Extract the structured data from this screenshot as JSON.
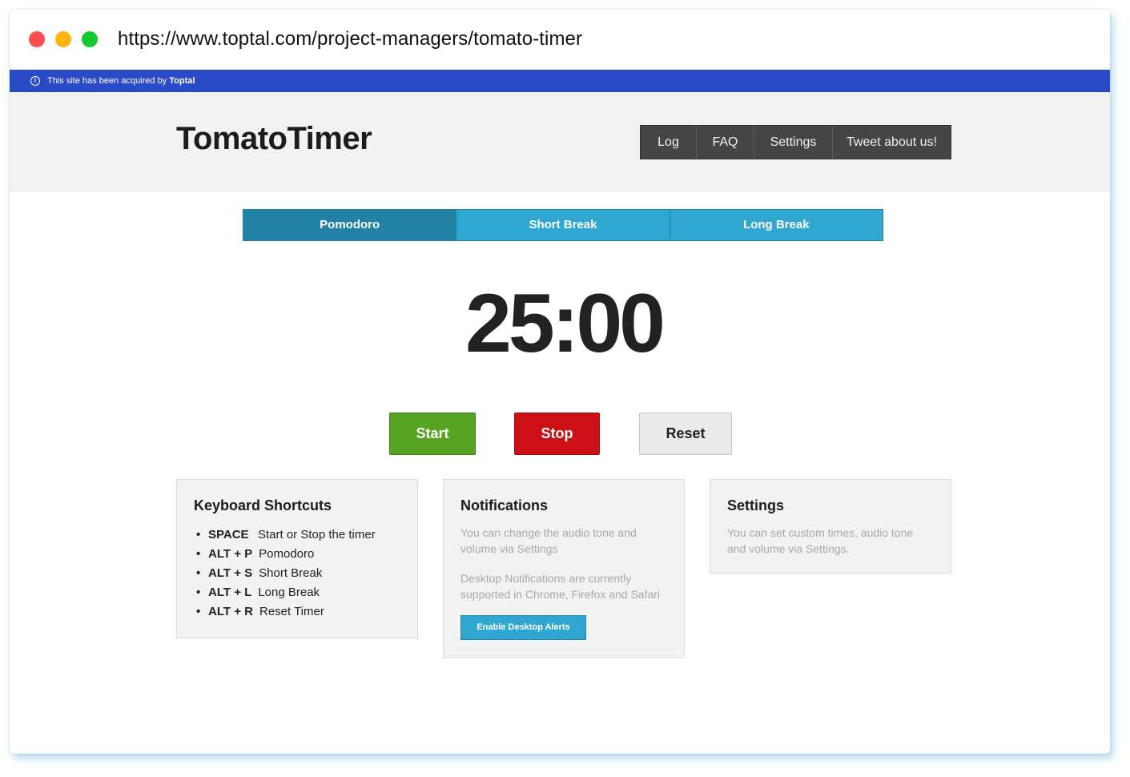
{
  "browser": {
    "url": "https://www.toptal.com/project-managers/tomato-timer"
  },
  "notice": {
    "icon": "info-icon",
    "text": "This site has been acquired by",
    "brand": "Toptal"
  },
  "header": {
    "logo": "TomatoTimer",
    "nav": [
      {
        "label": "Log"
      },
      {
        "label": "FAQ"
      },
      {
        "label": "Settings"
      },
      {
        "label": "Tweet about us!"
      }
    ]
  },
  "tabs": [
    {
      "label": "Pomodoro",
      "active": true
    },
    {
      "label": "Short Break",
      "active": false
    },
    {
      "label": "Long Break",
      "active": false
    }
  ],
  "timer": {
    "display": "25:00"
  },
  "controls": {
    "start": "Start",
    "stop": "Stop",
    "reset": "Reset"
  },
  "shortcuts_panel": {
    "title": "Keyboard Shortcuts",
    "items": [
      {
        "key": "SPACE",
        "desc": "Start or Stop the timer"
      },
      {
        "key": "ALT + P",
        "desc": "Pomodoro"
      },
      {
        "key": "ALT + S",
        "desc": "Short Break"
      },
      {
        "key": "ALT + L",
        "desc": "Long Break"
      },
      {
        "key": "ALT + R",
        "desc": "Reset Timer"
      }
    ]
  },
  "notifications_panel": {
    "title": "Notifications",
    "text1": "You can change the audio tone and volume via Settings",
    "text2": "Desktop Notifications are currently supported in Chrome, Firefox and Safari",
    "button": "Enable Desktop Alerts"
  },
  "settings_panel": {
    "title": "Settings",
    "text": "You can set custom times, audio tone and volume via Settings."
  },
  "colors": {
    "notice_bar": "#2a4bc7",
    "tab_active": "#2182a6",
    "tab": "#2fa7d0",
    "start": "#55a321",
    "stop": "#cc1016",
    "reset": "#eaeaea"
  }
}
